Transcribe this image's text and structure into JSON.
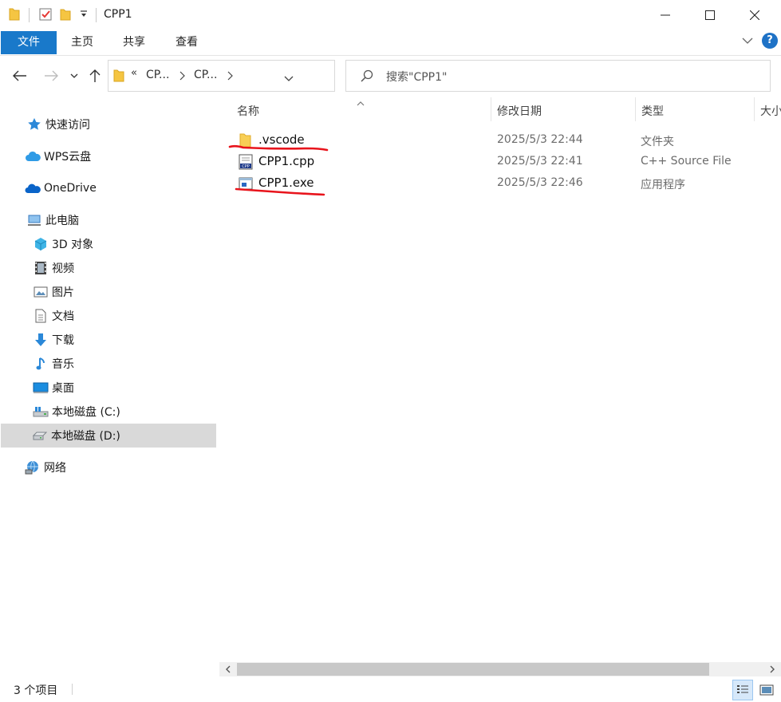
{
  "window": {
    "title": "CPP1",
    "controls": {
      "minimize": "minimize",
      "maximize": "maximize",
      "close": "close"
    }
  },
  "ribbon": {
    "tabs": [
      "文件",
      "主页",
      "共享",
      "查看"
    ],
    "active_tab": "文件",
    "accent_color": "#1979ca"
  },
  "address": {
    "crumbs": [
      "«",
      "CP...",
      "CP..."
    ],
    "search_placeholder": "搜索\"CPP1\""
  },
  "sidebar": {
    "items": [
      {
        "label": "快速访问",
        "icon": "star-icon"
      },
      {
        "label": "WPS云盘",
        "icon": "cloud-icon"
      },
      {
        "label": "OneDrive",
        "icon": "onedrive-cloud-icon"
      },
      {
        "label": "此电脑",
        "icon": "computer-icon"
      },
      {
        "label": "3D 对象",
        "icon": "cube-icon"
      },
      {
        "label": "视频",
        "icon": "film-icon"
      },
      {
        "label": "图片",
        "icon": "picture-icon"
      },
      {
        "label": "文档",
        "icon": "document-icon"
      },
      {
        "label": "下载",
        "icon": "download-arrow-icon"
      },
      {
        "label": "音乐",
        "icon": "music-note-icon"
      },
      {
        "label": "桌面",
        "icon": "desktop-icon"
      },
      {
        "label": "本地磁盘 (C:)",
        "icon": "system-drive-icon"
      },
      {
        "label": "本地磁盘 (D:)",
        "icon": "drive-icon"
      },
      {
        "label": "网络",
        "icon": "network-icon"
      }
    ],
    "selected": "本地磁盘 (D:)"
  },
  "columns": {
    "name": "名称",
    "modified": "修改日期",
    "type": "类型",
    "size": "大小"
  },
  "files": [
    {
      "name": ".vscode",
      "modified": "2025/5/3 22:44",
      "type": "文件夹",
      "icon": "folder-icon"
    },
    {
      "name": "CPP1.cpp",
      "modified": "2025/5/3 22:41",
      "type": "C++ Source File",
      "icon": "cpp-file-icon"
    },
    {
      "name": "CPP1.exe",
      "modified": "2025/5/3 22:46",
      "type": "应用程序",
      "icon": "exe-file-icon"
    }
  ],
  "status": {
    "item_count": "3 个项目"
  },
  "annotation_color": "#e8141c"
}
